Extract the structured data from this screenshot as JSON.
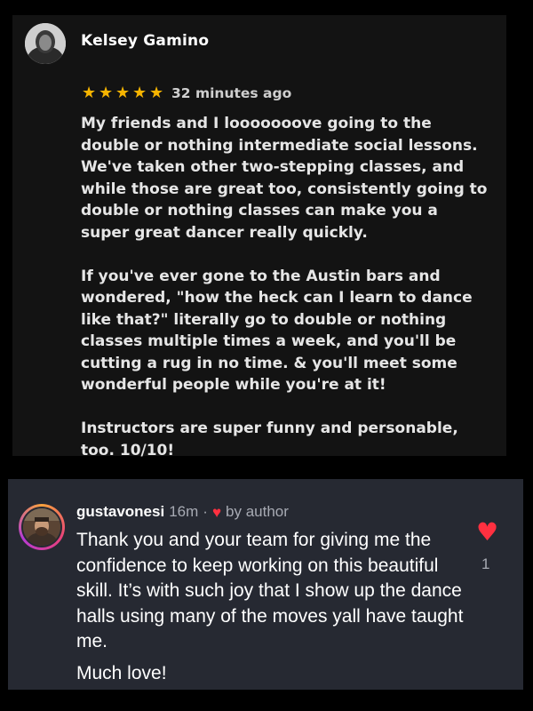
{
  "review": {
    "author": "Kelsey Gamino",
    "rating": 5,
    "stars": [
      "★",
      "★",
      "★",
      "★",
      "★"
    ],
    "time": "32 minutes ago",
    "paragraphs": [
      "My friends and I looooooove going to the double or nothing intermediate social lessons. We've taken other two-stepping classes, and while those are great too, consistently going to double or nothing classes can make you a super great dancer really quickly.",
      "If you've ever gone to the Austin bars and wondered, \"how the heck can I learn to dance like that?\" literally go to double or nothing classes multiple times a week, and you'll be cutting a rug in no time. & you'll meet some wonderful people while you're at it!",
      "Instructors are super funny and personable, too. 10/10!"
    ]
  },
  "comment": {
    "username": "gustavonesi",
    "time": "16m",
    "separator": "·",
    "heart_icon": "♥",
    "liked_label": "by author",
    "paragraphs": [
      "Thank you and your team for giving me the confidence to keep working on this beautiful skill. It’s with such joy that I show up the dance halls using many of the moves yall have taught me.",
      "Much love!"
    ],
    "like_icon": "♥",
    "like_count": "1"
  },
  "colors": {
    "star": "#f6b400",
    "heart": "#ff3040",
    "review_bg": "#131313",
    "comment_bg": "#262932"
  }
}
